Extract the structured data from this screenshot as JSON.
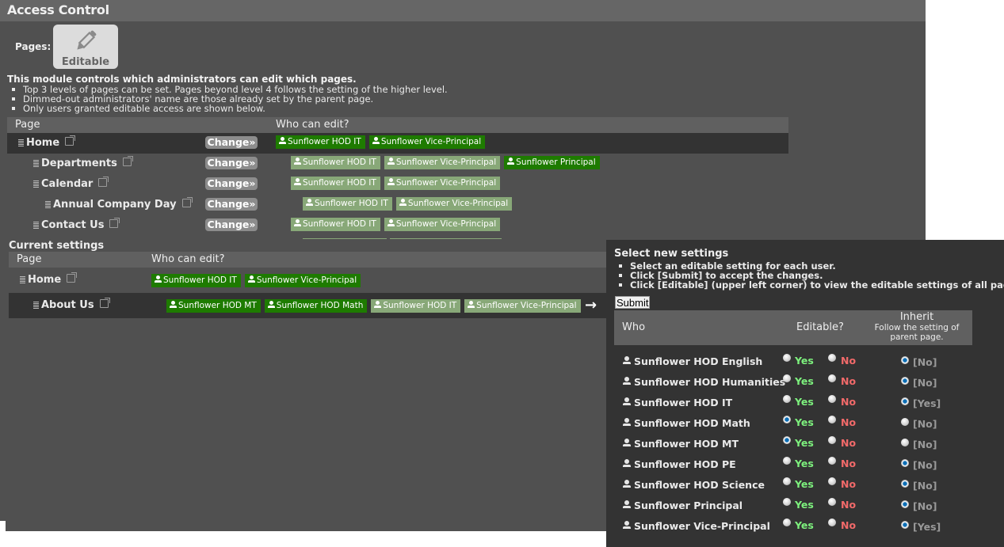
{
  "header": {
    "title": "Access Control"
  },
  "pages_label": "Pages:",
  "editable_button": {
    "label": "Editable",
    "icon": "pencil-icon"
  },
  "intro": {
    "heading": "This module controls which administrators can edit which pages.",
    "notes": [
      "Top 3 levels of pages can be set. Pages beyond level 4 follows the setting of the higher level.",
      "Dimmed-out administrators' name are those already set by the parent page.",
      "Only users granted editable access are shown below."
    ]
  },
  "page_table": {
    "columns": [
      "Page",
      "Who can edit?"
    ],
    "change_label": "Change»",
    "rows": [
      {
        "name": "Home",
        "level": 0,
        "selected": true,
        "editors": [
          {
            "name": "Sunflower HOD IT",
            "active": true
          },
          {
            "name": "Sunflower Vice-Principal",
            "active": true
          }
        ]
      },
      {
        "name": "Departments",
        "level": 1,
        "selected": false,
        "editors": [
          {
            "name": "Sunflower HOD IT",
            "active": false
          },
          {
            "name": "Sunflower Vice-Principal",
            "active": false
          },
          {
            "name": "Sunflower Principal",
            "active": true
          }
        ]
      },
      {
        "name": "Calendar",
        "level": 1,
        "selected": false,
        "editors": [
          {
            "name": "Sunflower HOD IT",
            "active": false
          },
          {
            "name": "Sunflower Vice-Principal",
            "active": false
          }
        ]
      },
      {
        "name": "Annual Company Day",
        "level": 2,
        "selected": false,
        "editors": [
          {
            "name": "Sunflower HOD IT",
            "active": false
          },
          {
            "name": "Sunflower Vice-Principal",
            "active": false
          }
        ]
      },
      {
        "name": "Contact Us",
        "level": 1,
        "selected": false,
        "editors": [
          {
            "name": "Sunflower HOD IT",
            "active": false
          },
          {
            "name": "Sunflower Vice-Principal",
            "active": false
          }
        ]
      }
    ]
  },
  "current_settings": {
    "title": "Current settings",
    "columns": [
      "Page",
      "Who can edit?"
    ],
    "rows": [
      {
        "name": "Home",
        "level": 0,
        "selected": false,
        "editors": [
          {
            "name": "Sunflower HOD IT",
            "active": true
          },
          {
            "name": "Sunflower Vice-Principal",
            "active": true
          }
        ]
      },
      {
        "name": "About Us",
        "level": 1,
        "selected": true,
        "editors": [
          {
            "name": "Sunflower HOD MT",
            "active": true
          },
          {
            "name": "Sunflower HOD Math",
            "active": true
          },
          {
            "name": "Sunflower HOD IT",
            "active": false
          },
          {
            "name": "Sunflower Vice-Principal",
            "active": false
          }
        ]
      }
    ],
    "arrow": "→"
  },
  "new_settings": {
    "title": "Select new settings",
    "notes": [
      "Select an editable setting for each user.",
      "Click [Submit] to accept the changes.",
      "Click [Editable] (upper left corner) to view the editable settings of all pages."
    ],
    "submit_label": "Submit",
    "columns": {
      "who": "Who",
      "editable": "Editable?",
      "inherit": "Inherit",
      "inherit_sub": "Follow the setting of parent page."
    },
    "yes_label": "Yes",
    "no_label": "No",
    "users": [
      {
        "name": "Sunflower HOD English",
        "choice": "inherit",
        "inherit_value": "[No]"
      },
      {
        "name": "Sunflower HOD Humanities",
        "choice": "inherit",
        "inherit_value": "[No]"
      },
      {
        "name": "Sunflower HOD IT",
        "choice": "inherit",
        "inherit_value": "[Yes]"
      },
      {
        "name": "Sunflower HOD Math",
        "choice": "yes",
        "inherit_value": "[No]"
      },
      {
        "name": "Sunflower HOD MT",
        "choice": "yes",
        "inherit_value": "[No]"
      },
      {
        "name": "Sunflower HOD PE",
        "choice": "inherit",
        "inherit_value": "[No]"
      },
      {
        "name": "Sunflower HOD Science",
        "choice": "inherit",
        "inherit_value": "[No]"
      },
      {
        "name": "Sunflower Principal",
        "choice": "inherit",
        "inherit_value": "[No]"
      },
      {
        "name": "Sunflower Vice-Principal",
        "choice": "inherit",
        "inherit_value": "[Yes]"
      }
    ]
  },
  "colors": {
    "active_editor": "#1e7b00",
    "inherited_editor": "#88a878",
    "yes": "#7df07d",
    "no": "#f26a6a"
  }
}
